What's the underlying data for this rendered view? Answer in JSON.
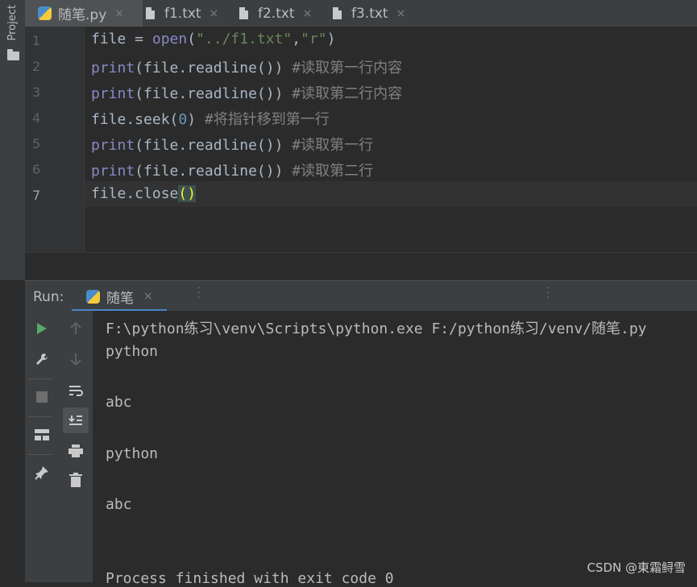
{
  "project_strip": {
    "label": "Project"
  },
  "tabs": [
    {
      "label": "随笔.py"
    },
    {
      "label": "f1.txt"
    },
    {
      "label": "f2.txt"
    },
    {
      "label": "f3.txt"
    }
  ],
  "close_glyph": "×",
  "editor": {
    "line_numbers": [
      "1",
      "2",
      "3",
      "4",
      "5",
      "6",
      "7"
    ],
    "lines": [
      {
        "t1": "file = ",
        "fn": "open",
        "t2": "(",
        "s1": "\"../f1.txt\"",
        "t3": ",",
        "s2": "\"r\"",
        "t4": ")"
      },
      {
        "fn": "print",
        "code": "(file.readline()) ",
        "comment": "#读取第一行内容"
      },
      {
        "fn": "print",
        "code": "(file.readline()) ",
        "comment": "#读取第二行内容"
      },
      {
        "t1": "file.seek(",
        "num": "0",
        "t2": ") ",
        "comment": "#将指针移到第一行"
      },
      {
        "fn": "print",
        "code": "(file.readline()) ",
        "comment": "#读取第一行"
      },
      {
        "fn": "print",
        "code": "(file.readline()) ",
        "comment": "#读取第二行"
      },
      {
        "t1": "file.close",
        "brackets": "()"
      }
    ]
  },
  "run_panel": {
    "label": "Run:",
    "tab_label": "随笔",
    "output": [
      "F:\\python练习\\venv\\Scripts\\python.exe F:/python练习/venv/随笔.py",
      "python",
      "",
      "abc",
      "",
      "python",
      "",
      "abc",
      "",
      "",
      "Process finished with exit code 0"
    ]
  },
  "icons": {
    "run": "play-icon",
    "wrench": "wrench-icon",
    "stop": "stop-icon",
    "layout": "layout-icon",
    "pin": "pin-icon",
    "up": "arrow-up-icon",
    "down": "arrow-down-icon",
    "wrap": "soft-wrap-icon",
    "scroll": "scroll-to-end-icon",
    "print": "print-icon",
    "trash": "trash-icon"
  },
  "colors": {
    "accent": "#4a88c7",
    "run_green": "#59a869"
  },
  "watermark": "CSDN @東霜鲟雪"
}
